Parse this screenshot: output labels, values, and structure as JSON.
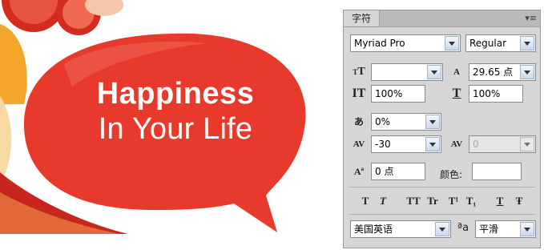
{
  "artwork": {
    "headline_line1": "Happiness",
    "headline_line2": "In Your Life",
    "bubble_color": "#e73a2c"
  },
  "panel": {
    "tab_label": "字符",
    "font_family": "Myriad Pro",
    "font_style": "Regular",
    "font_size": "",
    "leading": "29.65 点",
    "vertical_scale": "100%",
    "horizontal_scale": "100%",
    "tsume": "0%",
    "kerning": "-30",
    "tracking": "0",
    "baseline_shift": "0 点",
    "color_label": "颜色:",
    "language": "美国英语",
    "antialias_icon_label": "ªa",
    "antialias": "平滑",
    "format_buttons": [
      "T",
      "T",
      "TT",
      "Tr",
      "T¹",
      "T₁",
      "T",
      "Ŧ"
    ]
  }
}
